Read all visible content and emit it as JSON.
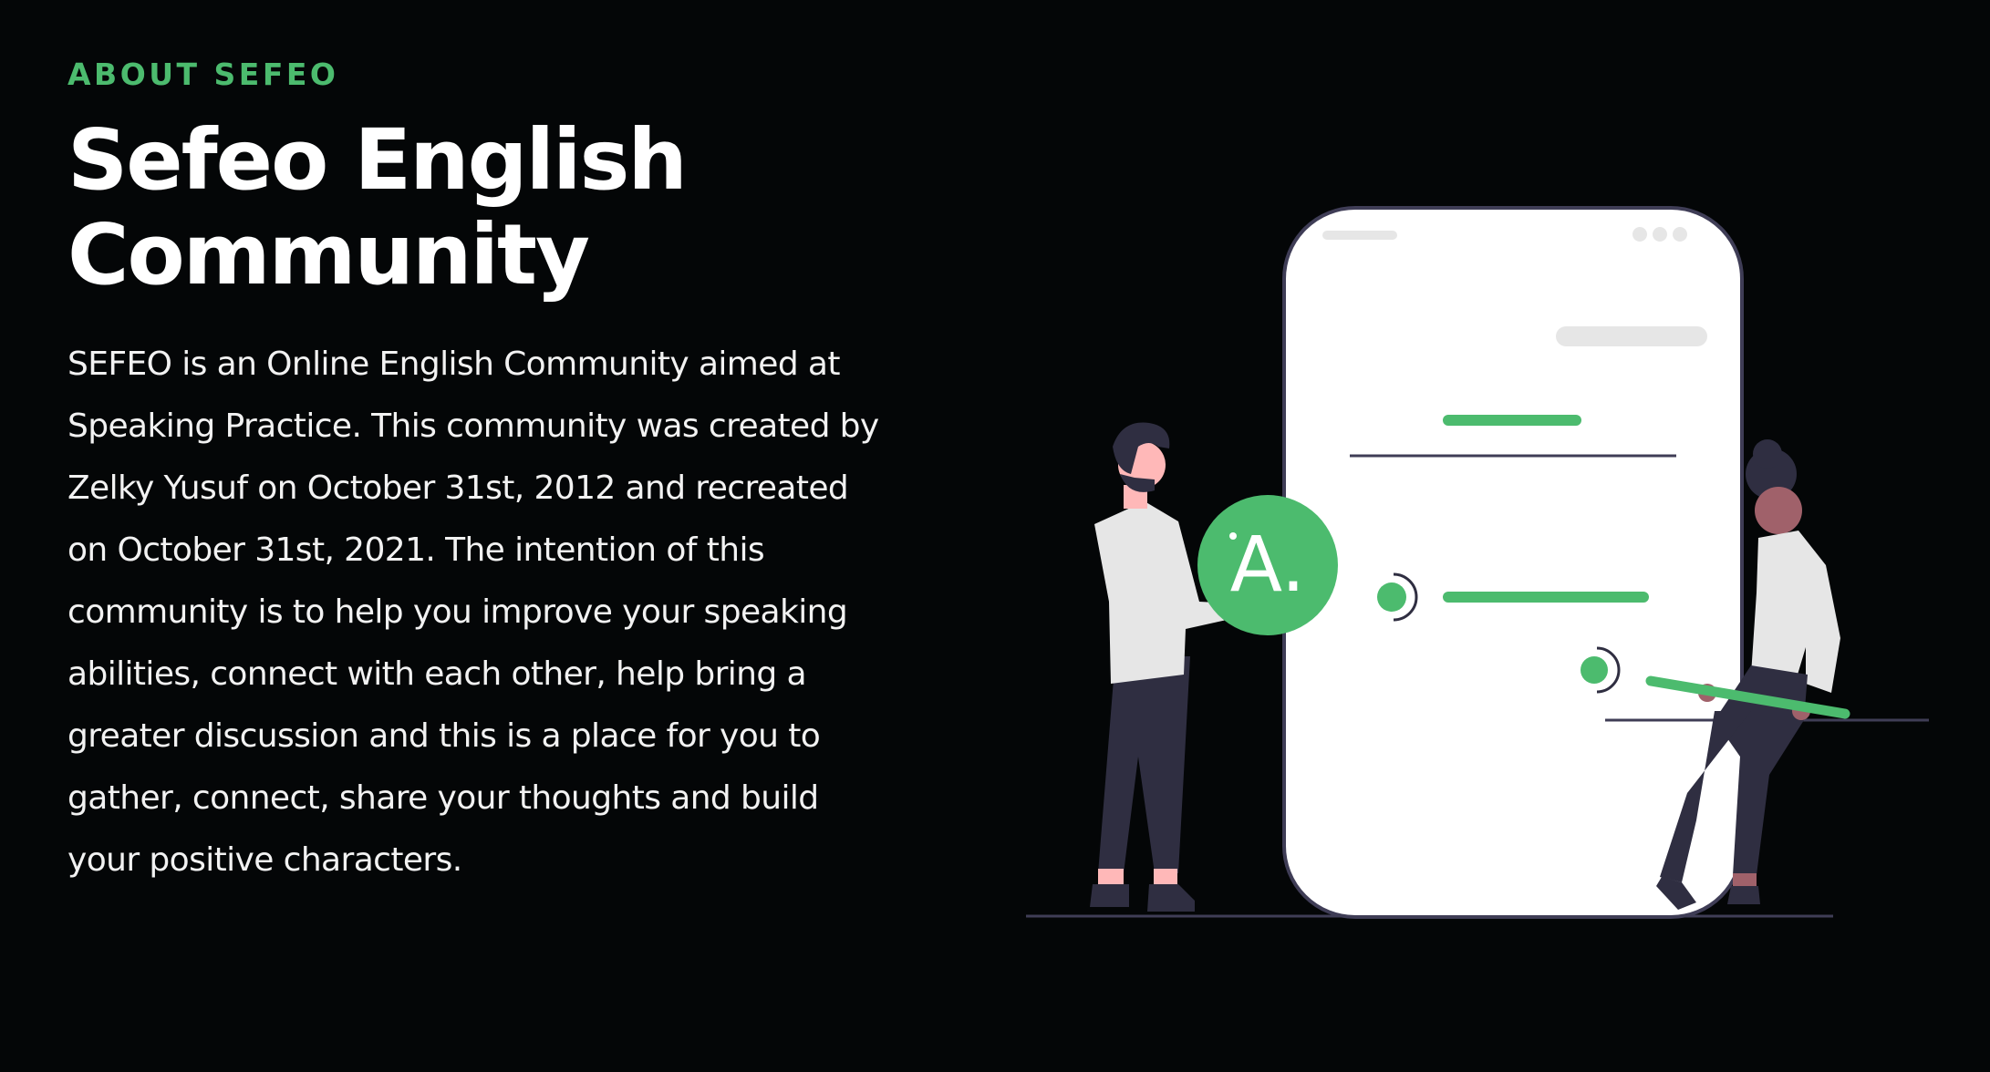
{
  "about": {
    "eyebrow": "ABOUT SEFEO",
    "title": "Sefeo English Community",
    "description": "SEFEO is an Online English Community aimed at Speaking Practice. This community was created by Zelky Yusuf on October 31st, 2012 and recreated on October 31st, 2021. The intention of this community is to help you improve your speaking abilities, connect with each other, help bring a greater discussion and this is a place for you to gather, connect, share your thoughts and build your positive characters."
  },
  "illustration": {
    "badge_letter": "A.",
    "accent_color": "#4cbb6e",
    "dark_color": "#2f2e41",
    "background_color": "#040607"
  }
}
